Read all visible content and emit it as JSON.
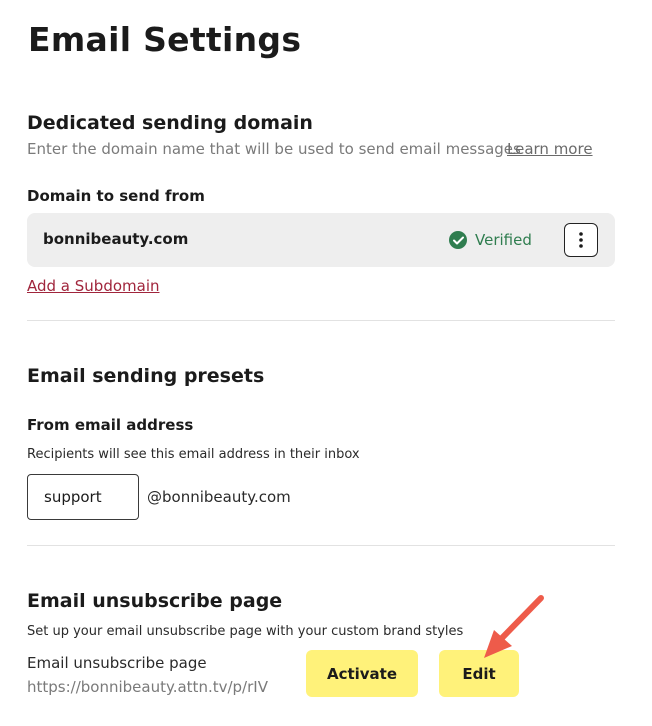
{
  "page": {
    "title": "Email Settings"
  },
  "sending_domain": {
    "heading": "Dedicated sending domain",
    "description": "Enter the domain name that will be used to send email messages",
    "learn_more": "Learn more",
    "field_label": "Domain to send from",
    "domain": "bonnibeauty.com",
    "status": "Verified",
    "status_color": "#2f7d4f",
    "add_subdomain": "Add a Subdomain",
    "link_color": "#a0253c"
  },
  "presets": {
    "heading": "Email sending presets",
    "from_label": "From email address",
    "from_help": "Recipients will see this email address in their inbox",
    "from_value": "support",
    "domain_suffix": "@bonnibeauty.com"
  },
  "unsubscribe": {
    "heading": "Email unsubscribe page",
    "description": "Set up your email unsubscribe page with your custom brand styles",
    "page_label": "Email unsubscribe page",
    "page_url": "https://bonnibeauty.attn.tv/p/rIV",
    "activate_label": "Activate",
    "edit_label": "Edit",
    "button_color": "#fff27a"
  },
  "annotation": {
    "arrow_color": "#ee5b4a"
  }
}
